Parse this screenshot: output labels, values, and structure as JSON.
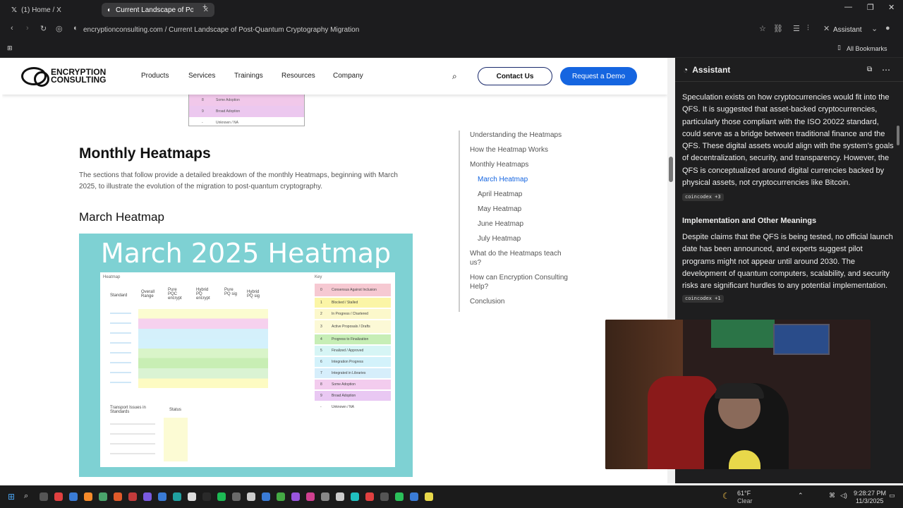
{
  "browser": {
    "tabs": [
      {
        "label": "(1) Home / X"
      },
      {
        "label": "Current Landscape of Post-Q"
      }
    ],
    "url": "encryptionconsulting.com / Current Landscape of Post-Quantum Cryptography Migration",
    "assistant_btn": "Assistant",
    "all_bookmarks": "All Bookmarks"
  },
  "site": {
    "logo_line1": "ENCRYPTION",
    "logo_line2": "CONSULTING",
    "nav": [
      "Products",
      "Services",
      "Trainings",
      "Resources",
      "Company"
    ],
    "contact_us": "Contact Us",
    "request_demo": "Request a Demo"
  },
  "top_image": {
    "rows": [
      "Some Adoption",
      "Broad Adoption",
      "Unknown / NA"
    ],
    "nums": [
      "8",
      "9",
      "-"
    ]
  },
  "article": {
    "heading": "Monthly Heatmaps",
    "intro": "The sections that follow provide a detailed breakdown of the monthly Heatmaps, beginning with March 2025, to illustrate the evolution of the migration to post-quantum cryptography.",
    "march_heading": "March Heatmap",
    "heatmap_title": "March 2025 Heatmap",
    "heatmap_label": "Heatmap",
    "key_label": "Key",
    "col_headers": [
      "Standard",
      "Overall Range",
      "Pure PQC encrypt",
      "Hybrid PQ encrypt",
      "Pure PQ sig",
      "Hybrid PQ sig"
    ],
    "transport_label": "Transport Issues in Standards",
    "status_label": "Status",
    "key_items": [
      "Consensus Against Inclusion",
      "Blocked / Stalled",
      "In Progress / Chartered",
      "Active Proposals / Drafts",
      "Progress to Finalization",
      "Finalized / Approved",
      "Integration Progress",
      "Integrated in Libraries",
      "Some Adoption",
      "Broad Adoption",
      "Unknown / NA"
    ],
    "key_nums": [
      "0",
      "1",
      "2",
      "3",
      "4",
      "5",
      "6",
      "7",
      "8",
      "9",
      "-"
    ]
  },
  "toc": {
    "items": [
      "Understanding the Heatmaps",
      "How the Heatmap Works",
      "Monthly Heatmaps",
      "March Heatmap",
      "April Heatmap",
      "May Heatmap",
      "June Heatmap",
      "July Heatmap",
      "What do the Heatmaps teach us?",
      "How can Encryption Consulting Help?",
      "Conclusion"
    ]
  },
  "assistant": {
    "title": "Assistant",
    "para1": "Speculation exists on how cryptocurrencies would fit into the QFS. It is suggested that asset-backed cryptocurrencies, particularly those compliant with the ISO 20022 standard, could serve as a bridge between traditional finance and the QFS. These digital assets would align with the system's goals of decentralization, security, and transparency. However, the QFS is conceptualized around digital currencies backed by physical assets, not cryptocurrencies like Bitcoin.",
    "chip1": "coincodex +3",
    "sub2": "Implementation and Other Meanings",
    "para2": "Despite claims that the QFS is being tested, no official launch date has been announced, and experts suggest pilot programs might not appear until around 2030. The development of quantum computers, scalability, and security risks are significant hurdles to any potential implementation.",
    "chip2": "coincodex +1"
  },
  "taskbar": {
    "weather_temp": "61°F",
    "weather_desc": "Clear",
    "time": "9:28:27 PM",
    "date": "11/3/2025"
  },
  "colors": {
    "accent": "#1565e0",
    "heat_bg": "#7ed1d3"
  }
}
